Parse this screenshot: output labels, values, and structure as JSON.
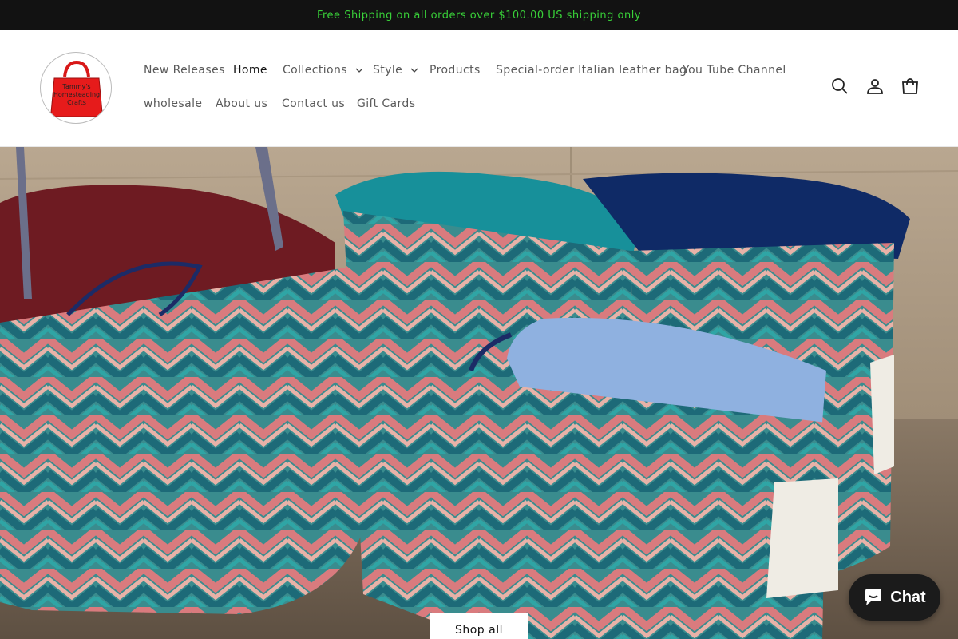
{
  "announcement": {
    "text": "Free Shipping on all orders over $100.00 US shipping only",
    "color": "#39d139"
  },
  "logo": {
    "text_lines": [
      "Tammy's",
      "Homesteading",
      "Crafts"
    ]
  },
  "nav": {
    "row1": [
      {
        "label": "New Releases"
      },
      {
        "label": "Home",
        "active": true
      },
      {
        "label": "Collections",
        "dropdown": true
      },
      {
        "label": "Style",
        "dropdown": true
      },
      {
        "label": "Products"
      },
      {
        "label": "Special-order Italian leather bag"
      },
      {
        "label": "You Tube Channel"
      }
    ],
    "row2": [
      {
        "label": "wholesale"
      },
      {
        "label": "About us"
      },
      {
        "label": "Contact us"
      },
      {
        "label": "Gift Cards"
      }
    ]
  },
  "header_icons": [
    "search-icon",
    "account-icon",
    "cart-icon"
  ],
  "hero": {
    "button_label": "Shop all"
  },
  "chat": {
    "label": "Chat"
  }
}
